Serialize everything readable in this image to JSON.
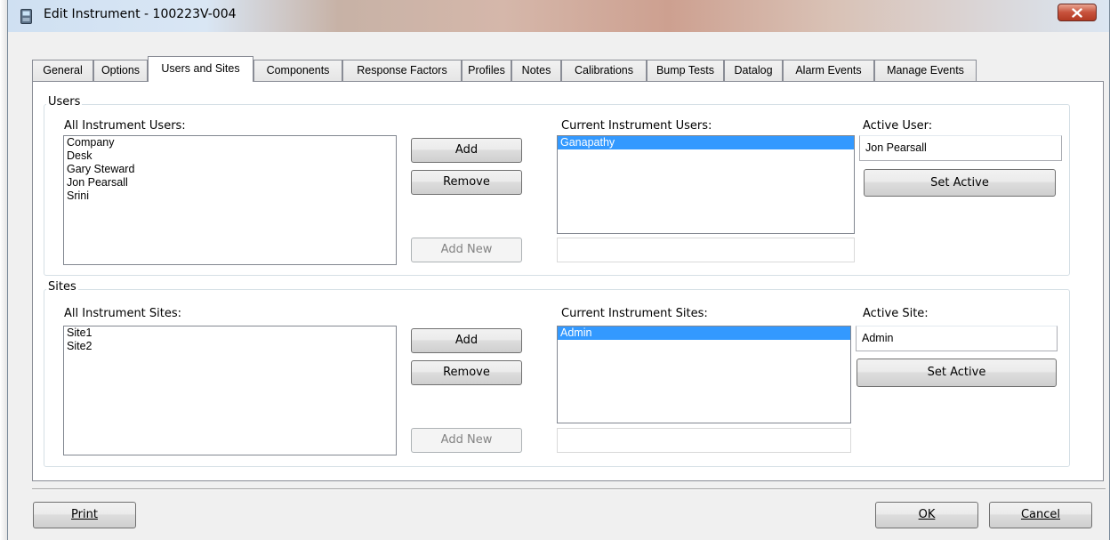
{
  "window": {
    "title": "Edit Instrument - 100223V-004",
    "close_icon": "close-icon",
    "app_icon": "instrument-icon",
    "close_color": "#c7523c"
  },
  "tabs": [
    {
      "label": "General",
      "active": false
    },
    {
      "label": "Options",
      "active": false
    },
    {
      "label": "Users and Sites",
      "active": true
    },
    {
      "label": "Components",
      "active": false
    },
    {
      "label": "Response Factors",
      "active": false
    },
    {
      "label": "Profiles",
      "active": false
    },
    {
      "label": "Notes",
      "active": false
    },
    {
      "label": "Calibrations",
      "active": false
    },
    {
      "label": "Bump Tests",
      "active": false
    },
    {
      "label": "Datalog",
      "active": false
    },
    {
      "label": "Alarm Events",
      "active": false
    },
    {
      "label": "Manage Events",
      "active": false
    }
  ],
  "users": {
    "group_title": "Users",
    "all_label": "All Instrument Users:",
    "all_items": [
      "Company",
      "Desk",
      "Gary Steward",
      "Jon Pearsall",
      "Srini"
    ],
    "add_label": "Add",
    "remove_label": "Remove",
    "add_new_label": "Add New",
    "current_label": "Current Instrument Users:",
    "current_items": [
      "Ganapathy"
    ],
    "current_selected": "Ganapathy",
    "new_value": "",
    "active_label": "Active User:",
    "active_value": "Jon Pearsall",
    "set_active_label": "Set Active"
  },
  "sites": {
    "group_title": "Sites",
    "all_label": "All Instrument Sites:",
    "all_items": [
      "Site1",
      "Site2"
    ],
    "add_label": "Add",
    "remove_label": "Remove",
    "add_new_label": "Add New",
    "current_label": "Current Instrument Sites:",
    "current_items": [
      "Admin"
    ],
    "current_selected": "Admin",
    "new_value": "",
    "active_label": "Active Site:",
    "active_value": "Admin",
    "set_active_label": "Set Active"
  },
  "footer": {
    "print_label": "Print",
    "ok_label": "OK",
    "cancel_label": "Cancel"
  },
  "colors": {
    "selection": "#3399ff",
    "dialog_bg": "#f0f0f0"
  }
}
